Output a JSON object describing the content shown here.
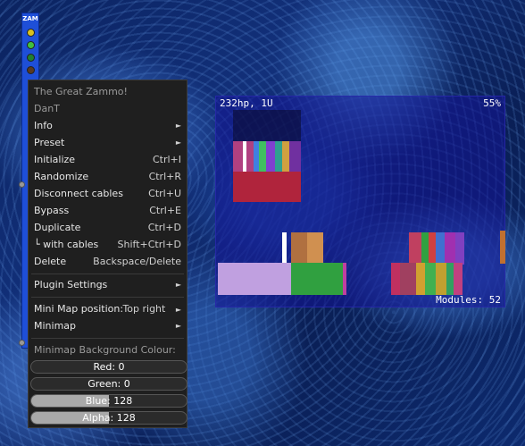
{
  "module": {
    "brand": "ZAM"
  },
  "minimap": {
    "size_label": "232hp, 1U",
    "zoom": "55%",
    "modules_label": "Modules: 52"
  },
  "menu": {
    "title": "The Great Zammo!",
    "author": "DanT",
    "items": {
      "info": "Info",
      "preset": "Preset",
      "initialize": "Initialize",
      "initialize_sc": "Ctrl+I",
      "randomize": "Randomize",
      "randomize_sc": "Ctrl+R",
      "disconnect": "Disconnect cables",
      "disconnect_sc": "Ctrl+U",
      "bypass": "Bypass",
      "bypass_sc": "Ctrl+E",
      "duplicate": "Duplicate",
      "duplicate_sc": "Ctrl+D",
      "with_cables": "└ with cables",
      "with_cables_sc": "Shift+Ctrl+D",
      "delete": "Delete",
      "delete_sc": "Backspace/Delete",
      "plugin_settings": "Plugin Settings",
      "minimap_position": "Mini Map position:",
      "minimap_position_value": "Top right",
      "minimap": "Minimap",
      "bg_colour": "Minimap Background Colour:"
    },
    "arrow": "►",
    "sliders": {
      "red": {
        "text": "Red: 0",
        "value": 0
      },
      "green": {
        "text": "Green: 0",
        "value": 0
      },
      "blue": {
        "text": "Blue: 128",
        "value": 128
      },
      "alpha": {
        "text": "Alpha: 128",
        "value": 128
      }
    }
  }
}
